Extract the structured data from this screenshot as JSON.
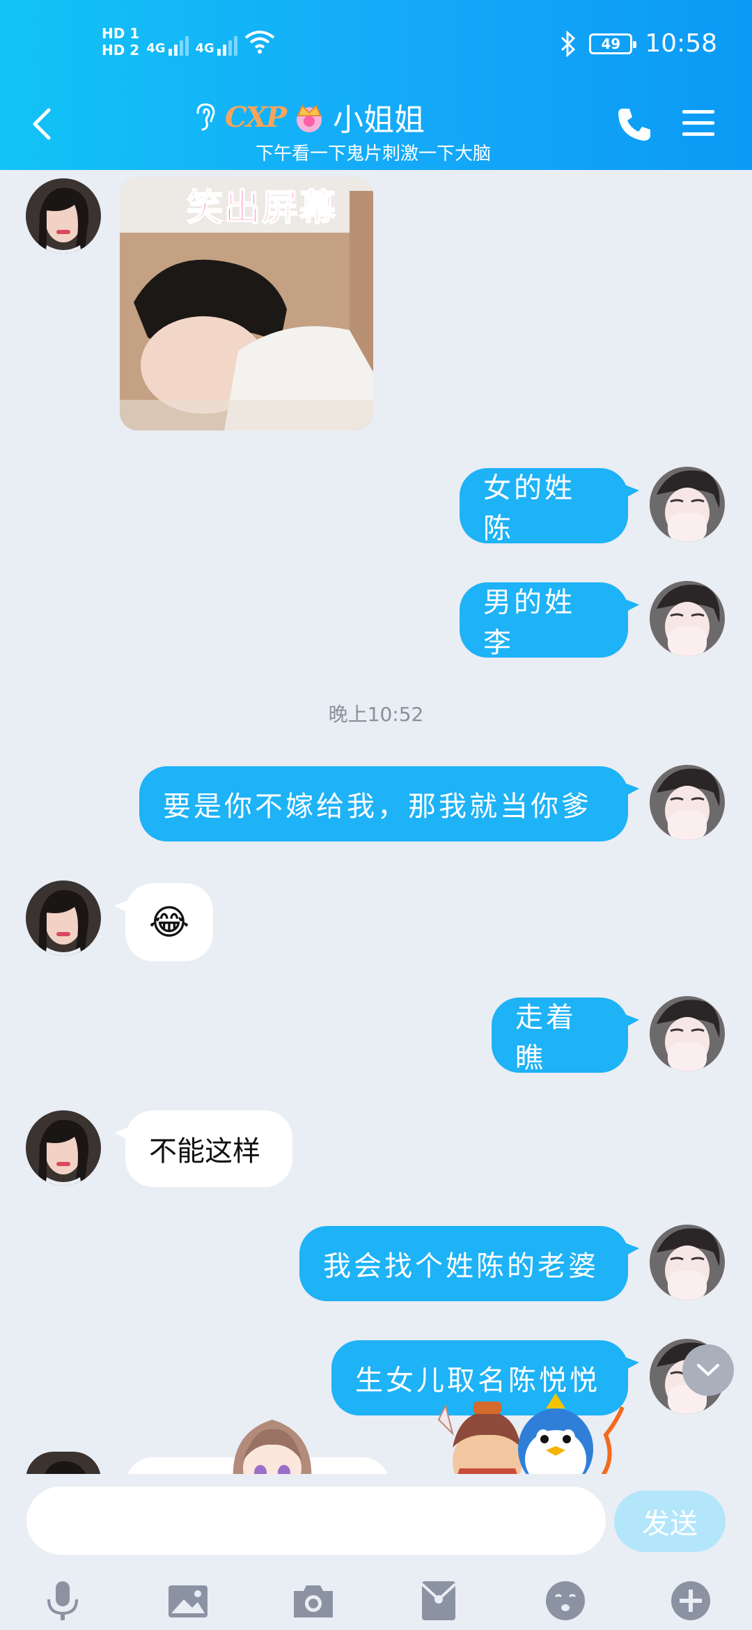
{
  "status": {
    "sim1": "HD 1",
    "sim2": "HD 2",
    "net1": "4G",
    "net2": "4G",
    "battery": "49",
    "time": "10:58"
  },
  "header": {
    "badge": "CXP",
    "title": "小姐姐",
    "subtitle": "下午看一下鬼片刺激一下大脑"
  },
  "messages": {
    "m1": "女的姓陈",
    "m2": "男的姓李",
    "timestamp": "晚上10:52",
    "m3": "要是你不嫁给我，那我就当你爹",
    "m4": "😂",
    "m5": "走着瞧",
    "m6": "不能这样",
    "m7": "我会找个姓陈的老婆",
    "m8": "生女儿取名陈悦悦",
    "photo_caption": "笑出屏幕"
  },
  "input": {
    "placeholder": "",
    "send_label": "发送"
  },
  "colors": {
    "accent": "#1eb2f6",
    "header_start": "#12c3f6",
    "header_end": "#0b9af5",
    "background": "#e9edf4"
  }
}
